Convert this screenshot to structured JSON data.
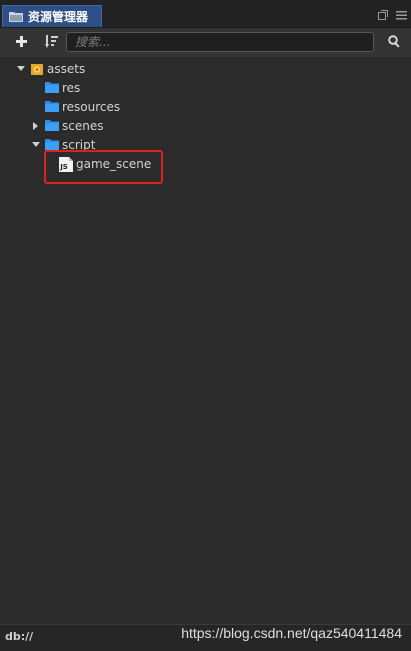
{
  "tab": {
    "title": "资源管理器"
  },
  "toolbar": {
    "add_icon": "plus-icon",
    "sort_icon": "sort-icon",
    "search_placeholder": "搜索...",
    "search_icon": "search-icon"
  },
  "tree": {
    "items": [
      {
        "label": "assets",
        "type": "db-folder",
        "expanded": true
      },
      {
        "label": "res",
        "type": "folder"
      },
      {
        "label": "resources",
        "type": "folder"
      },
      {
        "label": "scenes",
        "type": "folder",
        "expanded": false
      },
      {
        "label": "script",
        "type": "folder",
        "expanded": true
      },
      {
        "label": "game_scene",
        "type": "js-file",
        "badge": "JS"
      }
    ]
  },
  "status": {
    "path": "db://"
  },
  "watermark": "https://blog.csdn.net/qaz540411484",
  "colors": {
    "accent": "#2c4f86",
    "folder": "#2e8ee6",
    "highlight": "#e02020"
  }
}
